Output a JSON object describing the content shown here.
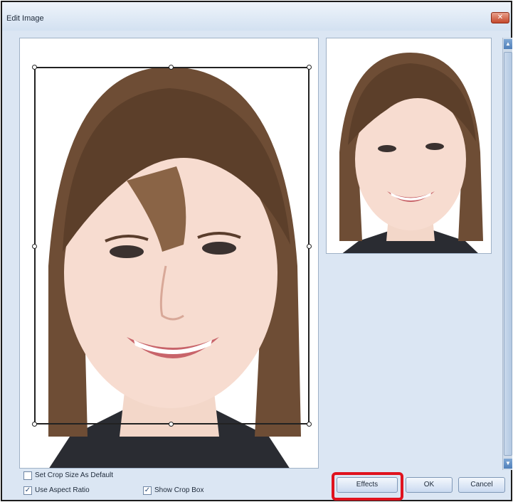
{
  "window": {
    "title": "Edit Image",
    "close_glyph": "✕"
  },
  "canvas": {
    "image_name": "portrait-photo"
  },
  "preview": {
    "image_name": "portrait-preview"
  },
  "scrollbar": {
    "up_glyph": "▲",
    "down_glyph": "▼"
  },
  "options": {
    "set_default": {
      "label": "Set Crop Size As Default",
      "checked": false
    },
    "aspect_ratio": {
      "label": "Use Aspect Ratio",
      "checked": true
    },
    "show_crop": {
      "label": "Show Crop Box",
      "checked": true
    }
  },
  "buttons": {
    "effects": "Effects",
    "ok": "OK",
    "cancel": "Cancel"
  },
  "colors": {
    "highlight": "#e0131e",
    "window_bg": "#dbe6f3",
    "accent": "#4f7fb9"
  }
}
